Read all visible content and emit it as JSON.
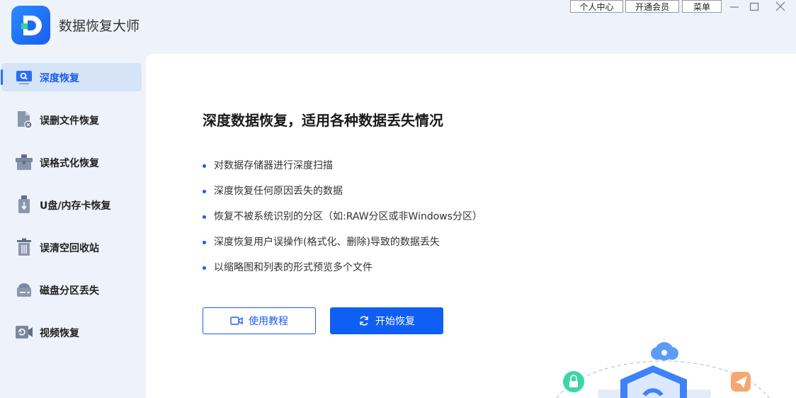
{
  "app": {
    "title": "数据恢复大师"
  },
  "topbar": {
    "user_center": "个人中心",
    "vip": "开通会员",
    "menu": "菜单",
    "window_controls": [
      "minimize-icon",
      "maximize-icon",
      "close-icon"
    ]
  },
  "sidebar": {
    "items": [
      {
        "label": "深度恢复",
        "icon": "search-icon",
        "active": true
      },
      {
        "label": "误删文件恢复",
        "icon": "deleted-file-icon",
        "active": false
      },
      {
        "label": "误格式化恢复",
        "icon": "toolbox-icon",
        "active": false
      },
      {
        "label": "U盘/内存卡恢复",
        "icon": "usb-icon",
        "active": false
      },
      {
        "label": "误清空回收站",
        "icon": "trash-icon",
        "active": false
      },
      {
        "label": "磁盘分区丢失",
        "icon": "disk-icon",
        "active": false
      },
      {
        "label": "视频恢复",
        "icon": "video-icon",
        "active": false
      }
    ]
  },
  "main": {
    "heading": "深度数据恢复，适用各种数据丢失情况",
    "features": [
      "对数据存储器进行深度扫描",
      "深度恢复任何原因丢失的数据",
      "恢复不被系统识别的分区（如:RAW分区或非Windows分区）",
      "深度恢复用户误操作(格式化、删除)导致的数据丢失",
      "以缩略图和列表的形式预览多个文件"
    ],
    "tutorial_button": "使用教程",
    "start_button": "开始恢复"
  },
  "colors": {
    "accent": "#0f5ff5",
    "sidebar_bg": "#eef3fb",
    "active_item_bg": "#d6e4f8"
  }
}
